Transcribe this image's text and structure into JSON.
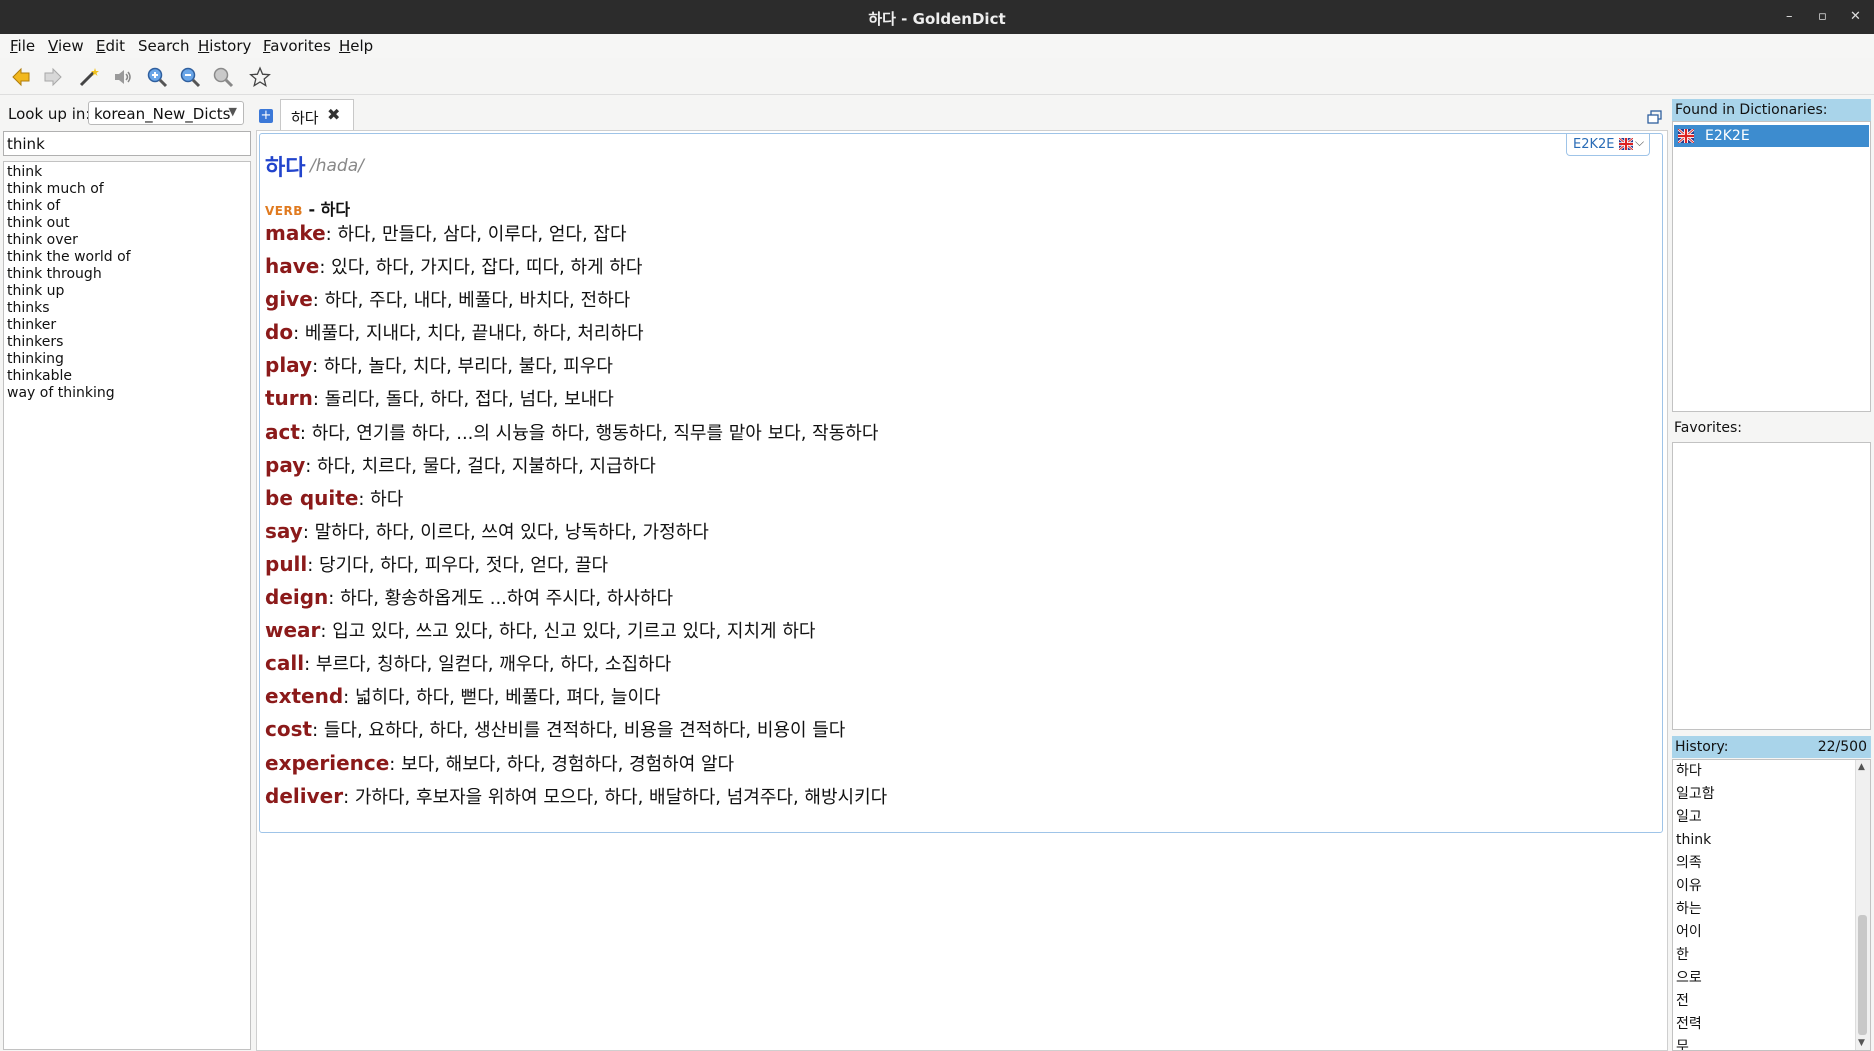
{
  "window": {
    "title": "하다 - GoldenDict",
    "minimize": "–",
    "restore": "▫",
    "close": "✕"
  },
  "menu": [
    {
      "label": "File",
      "key": "F",
      "rest": "ile"
    },
    {
      "label": "View",
      "key": "V",
      "rest": "iew"
    },
    {
      "label": "Edit",
      "key": "E",
      "rest": "dit"
    },
    {
      "label": "Search",
      "key": "",
      "rest": "Search"
    },
    {
      "label": "History",
      "key": "H",
      "rest": "istory"
    },
    {
      "label": "Favorites",
      "key": "F",
      "rest": "avorites"
    },
    {
      "label": "Help",
      "key": "H",
      "rest": "elp"
    }
  ],
  "toolbar": {
    "icons": [
      "back-icon",
      "forward-icon",
      "scan-popup-icon",
      "pronounce-icon",
      "zoom-in-icon",
      "zoom-out-icon",
      "zoom-reset-icon",
      "add-favorite-icon"
    ]
  },
  "lookup": {
    "label": "Look up in:",
    "group": "korean_New_Dicts",
    "query": "think"
  },
  "word_list": [
    "think",
    "think much of",
    "think of",
    "think out",
    "think over",
    "think the world of",
    "think through",
    "think up",
    "thinks",
    "thinker",
    "thinkers",
    "thinking",
    "thinkable",
    "way of thinking"
  ],
  "tabs": {
    "new_tab_symbol": "+",
    "active_label": "하다",
    "close_symbol": "✖"
  },
  "article": {
    "dict_name": "E2K2E",
    "headword": "하다",
    "transcription": "/hada/",
    "pos": "VERB",
    "pos_separator": " - ",
    "pos_headword": "하다",
    "entries": [
      {
        "word": "make",
        "translation": ": 하다, 만들다, 삼다, 이루다, 얻다, 잡다"
      },
      {
        "word": "have",
        "translation": ": 있다, 하다, 가지다, 잡다, 띠다, 하게 하다"
      },
      {
        "word": "give",
        "translation": ": 하다, 주다, 내다, 베풀다, 바치다, 전하다"
      },
      {
        "word": "do",
        "translation": ": 베풀다, 지내다, 치다, 끝내다, 하다, 처리하다"
      },
      {
        "word": "play",
        "translation": ": 하다, 놀다, 치다, 부리다, 불다, 피우다"
      },
      {
        "word": "turn",
        "translation": ": 돌리다, 돌다, 하다, 접다, 넘다, 보내다"
      },
      {
        "word": "act",
        "translation": ": 하다, 연기를 하다, ...의 시늉을 하다, 행동하다, 직무를 맡아 보다, 작동하다"
      },
      {
        "word": "pay",
        "translation": ": 하다, 치르다, 물다, 걸다, 지불하다, 지급하다"
      },
      {
        "word": "be quite",
        "translation": ": 하다"
      },
      {
        "word": "say",
        "translation": ": 말하다, 하다, 이르다, 쓰여 있다, 낭독하다, 가정하다"
      },
      {
        "word": "pull",
        "translation": ": 당기다, 하다, 피우다, 젓다, 얻다, 끌다"
      },
      {
        "word": "deign",
        "translation": ": 하다, 황송하옵게도 ...하여 주시다, 하사하다"
      },
      {
        "word": "wear",
        "translation": ": 입고 있다, 쓰고 있다, 하다, 신고 있다, 기르고 있다, 지치게 하다"
      },
      {
        "word": "call",
        "translation": ": 부르다, 칭하다, 일컫다, 깨우다, 하다, 소집하다"
      },
      {
        "word": "extend",
        "translation": ": 넓히다, 하다, 뻗다, 베풀다, 펴다, 늘이다"
      },
      {
        "word": "cost",
        "translation": ": 들다, 요하다, 하다, 생산비를 견적하다, 비용을 견적하다, 비용이 들다"
      },
      {
        "word": "experience",
        "translation": ": 보다, 해보다, 하다, 경험하다, 경험하여 알다"
      },
      {
        "word": "deliver",
        "translation": ": 가하다, 후보자을 위하여 모으다, 하다, 배달하다, 넘겨주다, 해방시키다"
      }
    ]
  },
  "right_pane": {
    "found_label": "Found in Dictionaries:",
    "found_items": [
      "E2K2E"
    ],
    "favorites_label": "Favorites:",
    "history_label": "History:",
    "history_count": "22/500",
    "history_items": [
      "하다",
      "일고함",
      "일고",
      "think",
      "의족",
      "이유",
      "하는",
      "어이",
      "한",
      "으로",
      "전",
      "전력",
      "무"
    ]
  },
  "colors": {
    "pane_header": "#a9d4ea",
    "selection": "#3d8ccf",
    "headword": "#2244cc",
    "entry_word": "#8b1a1a",
    "pos": "#e07a1f"
  }
}
